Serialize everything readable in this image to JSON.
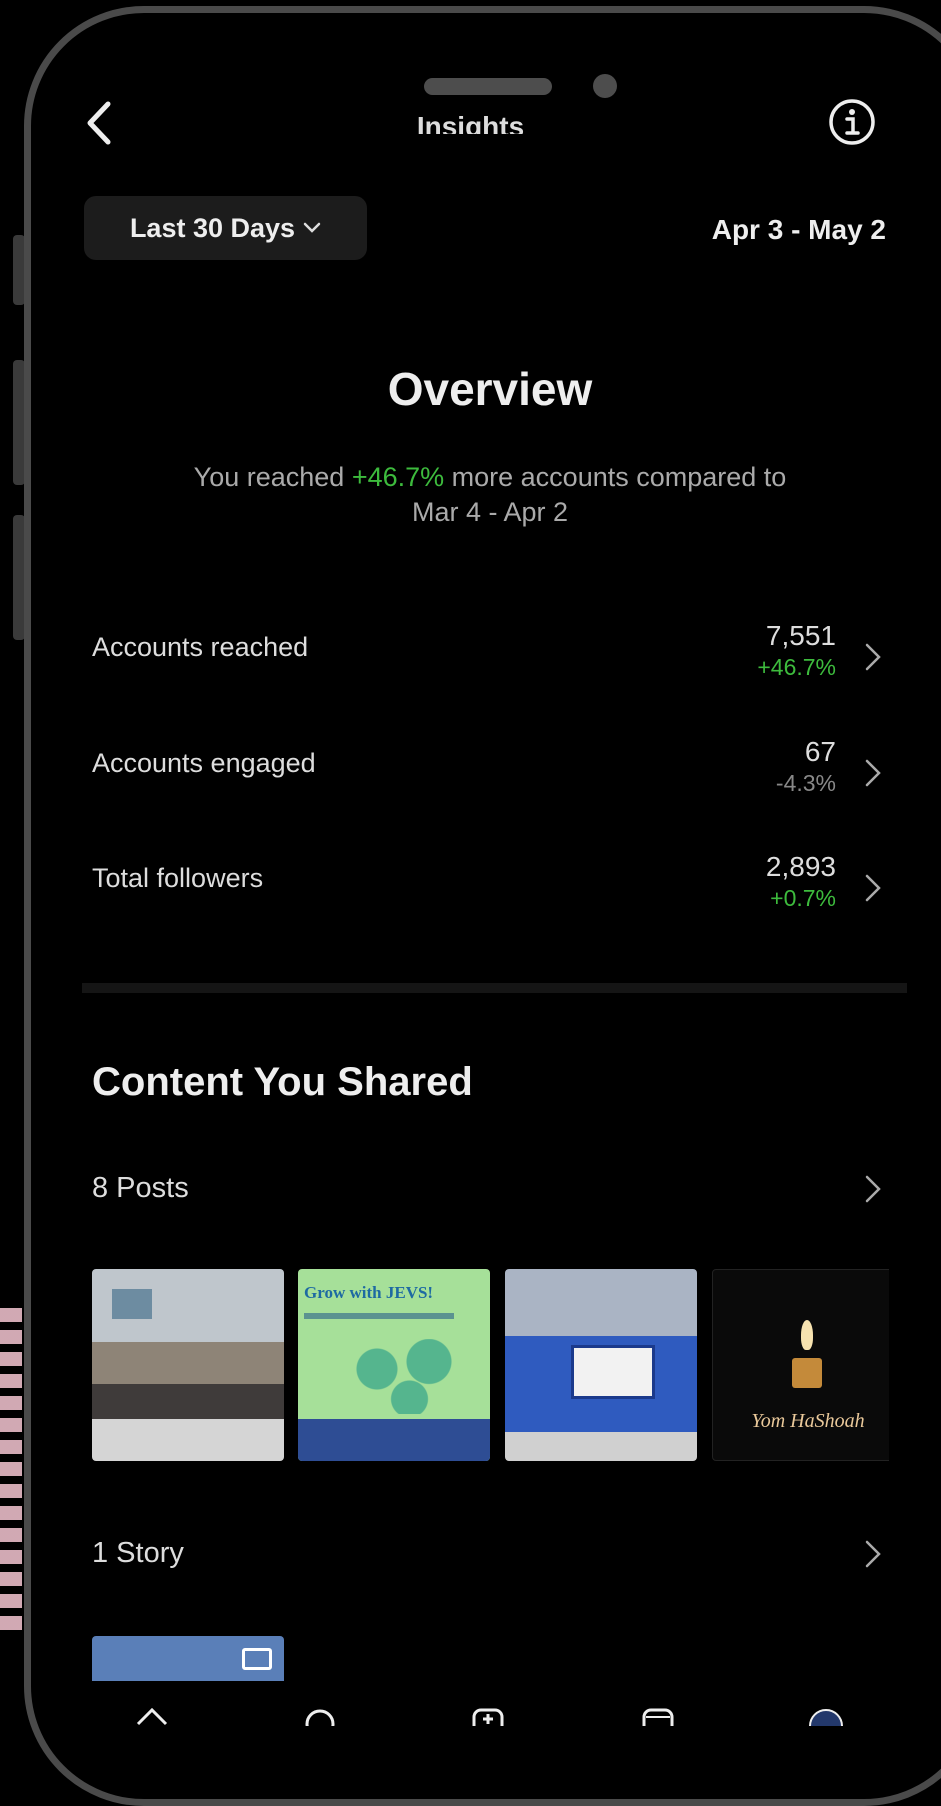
{
  "header": {
    "title": "Insights",
    "back_icon": "chevron-left-icon",
    "info_icon": "info-icon"
  },
  "filter": {
    "range_label": "Last 30 Days",
    "date_range": "Apr 3 - May 2"
  },
  "overview": {
    "title": "Overview",
    "sub_prefix": "You reached ",
    "sub_change": "+46.7%",
    "sub_suffix": " more accounts compared to",
    "compare_range": "Mar 4 - Apr 2"
  },
  "stats": [
    {
      "label": "Accounts reached",
      "value": "7,551",
      "change": "+46.7%",
      "trend": "positive"
    },
    {
      "label": "Accounts engaged",
      "value": "67",
      "change": "-4.3%",
      "trend": "negative"
    },
    {
      "label": "Total followers",
      "value": "2,893",
      "change": "+0.7%",
      "trend": "positive"
    }
  ],
  "content": {
    "title": "Content You Shared",
    "posts_label": "8 Posts",
    "post_thumbs": [
      {
        "caption": ""
      },
      {
        "caption": "Grow with JEVS!"
      },
      {
        "caption": ""
      },
      {
        "caption": "Yom HaShoah"
      }
    ],
    "story_label": "1 Story"
  },
  "tabs": [
    "home-icon",
    "search-icon",
    "create-icon",
    "reels-icon",
    "profile-icon"
  ],
  "colors": {
    "positive": "#3dbb3d",
    "background": "#000000"
  }
}
